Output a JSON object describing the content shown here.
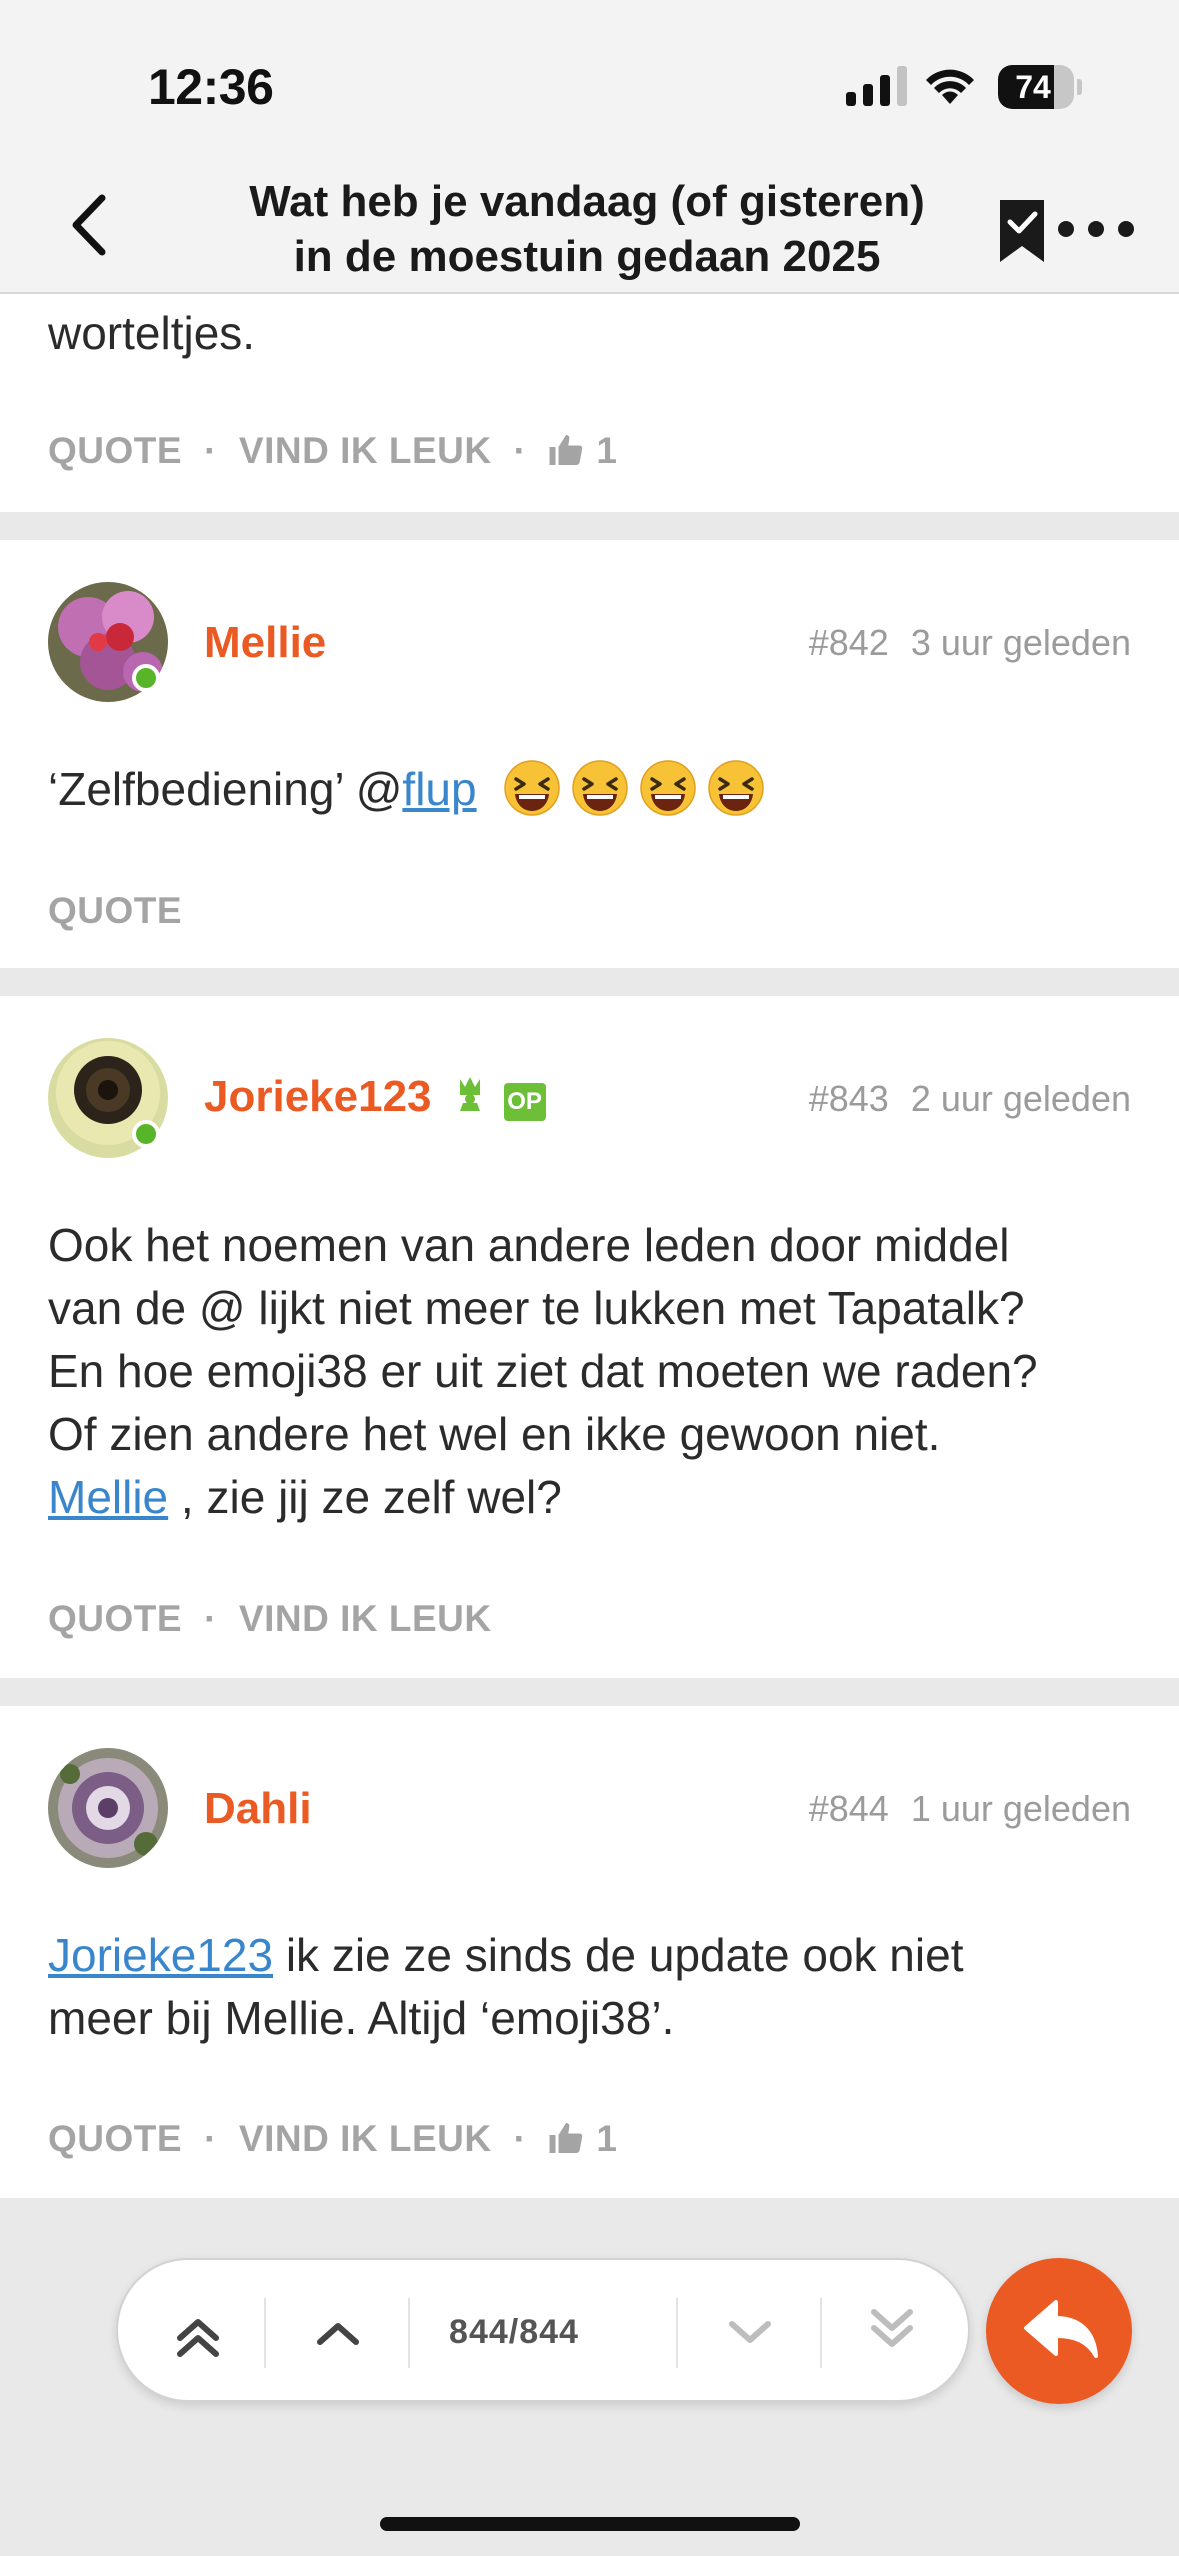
{
  "status": {
    "time": "12:36",
    "battery": "74",
    "battery_level": 0.74
  },
  "nav": {
    "title_line1": "Wat heb je vandaag (of gisteren)",
    "title_line2": "in de moestuin gedaan 2025"
  },
  "posts": [
    {
      "text_tail": "worteltjes.",
      "actions": {
        "quote": "QUOTE",
        "like": "VIND IK LEUK",
        "like_count": "1"
      }
    },
    {
      "author": "Mellie",
      "number": "#842",
      "time": "3 uur geleden",
      "text_prefix": "‘Zelfbediening’ @",
      "mention": "flup",
      "actions": {
        "quote": "QUOTE"
      }
    },
    {
      "author": "Jorieke123",
      "op_badge": "OP",
      "number": "#843",
      "time": "2 uur geleden",
      "lines": [
        "Ook het noemen van andere leden door middel",
        "van de @ lijkt niet meer te lukken met Tapatalk?",
        "En hoe emoji38 er uit ziet dat moeten we raden?",
        "Of zien andere het wel en ikke gewoon niet."
      ],
      "mention": "Mellie",
      "mention_suffix": " , zie jij ze zelf wel?",
      "actions": {
        "quote": "QUOTE",
        "like": "VIND IK LEUK"
      }
    },
    {
      "author": "Dahli",
      "number": "#844",
      "time": "1 uur geleden",
      "mention": "Jorieke123",
      "line1_suffix": " ik zie ze sinds de update ook niet",
      "line2": "meer bij Mellie. Altijd ‘emoji38’.",
      "actions": {
        "quote": "QUOTE",
        "like": "VIND IK LEUK",
        "like_count": "1"
      }
    }
  ],
  "pager": {
    "position": "844/844"
  },
  "colors": {
    "accent": "#ea5a22",
    "link": "#3a86cc",
    "online": "#58b52a",
    "op_badge": "#6cbf36"
  }
}
